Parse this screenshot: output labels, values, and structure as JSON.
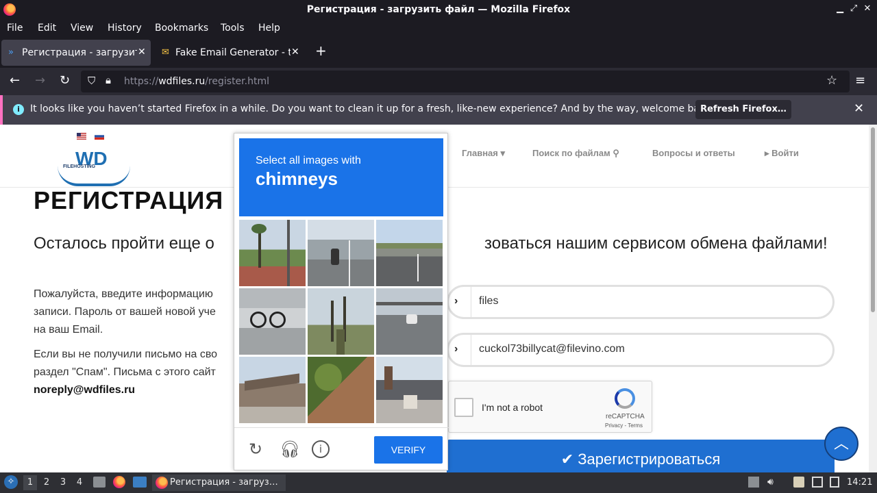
{
  "window": {
    "title": "Регистрация - загрузить файл — Mozilla Firefox",
    "controls": [
      "minimize",
      "maximize",
      "close"
    ]
  },
  "menu": [
    "File",
    "Edit",
    "View",
    "History",
    "Bookmarks",
    "Tools",
    "Help"
  ],
  "tabs": [
    {
      "label": "Регистрация - загрузить",
      "active": true
    },
    {
      "label": "Fake Email Generator - te",
      "active": false
    }
  ],
  "url": {
    "scheme": "https://",
    "host": "wdfiles.ru",
    "path": "/register.html"
  },
  "notification": {
    "message": "It looks like you haven’t started Firefox in a while. Do you want to clean it up for a fresh, like-new experience? And by the way, welcome back!",
    "button": "Refresh Firefox…"
  },
  "site": {
    "logo_text": "WD",
    "logo_sub": "FILEHOSTING",
    "nav": [
      "Главная ▾",
      "Поиск по файлам ⚲",
      "Вопросы и ответы",
      "▸ Войти"
    ],
    "heading": "РЕГИСТРАЦИЯ",
    "subtitle_start": "Осталось пройти еще о",
    "subtitle_end": "зоваться нашим сервисом обмена файлами!",
    "para1": [
      "Пожалуйста, введите информацию",
      "записи. Пароль от вашей новой уче",
      "на ваш Email."
    ],
    "para2": [
      "Если вы не получили письмо на сво",
      "раздел \"Спам\". Письма с этого сайт",
      "noreply@wdfiles.ru"
    ],
    "username_value": "files",
    "email_value": "cuckol73billycat@filevino.com",
    "recaptcha_label": "I'm not a robot",
    "recaptcha_brand": "reCAPTCHA",
    "recaptcha_terms": "Privacy - Terms",
    "register_button": "✔ Зарегистрироваться"
  },
  "captcha": {
    "instruction": "Select all images with",
    "target": "chimneys",
    "verify_label": "VERIFY"
  },
  "taskbar": {
    "workspaces": [
      "1",
      "2",
      "3",
      "4"
    ],
    "task_label": "Регистрация - загруз…",
    "clock": "14:21"
  },
  "colors": {
    "accent": "#1a73e8",
    "notification_stripe": "#ff71c1",
    "register_button": "#1f6fd1"
  }
}
